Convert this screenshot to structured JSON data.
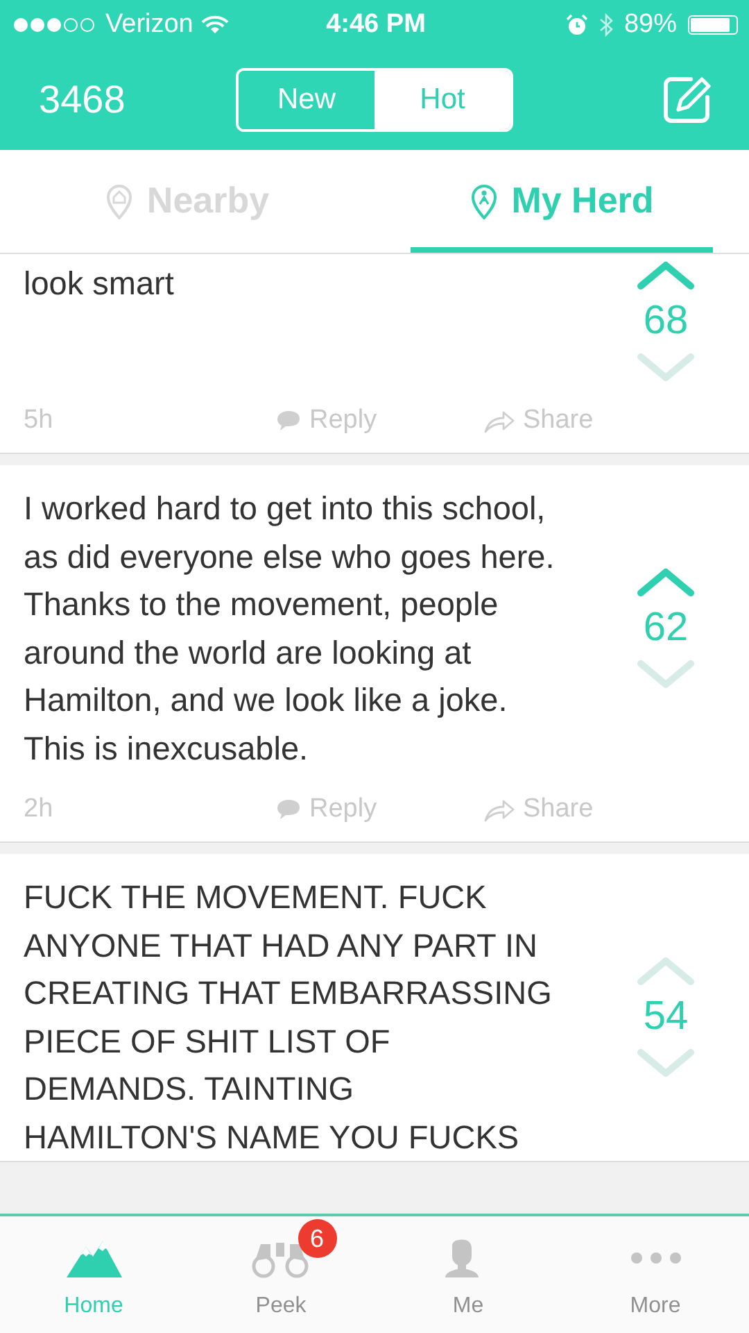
{
  "status_bar": {
    "carrier": "Verizon",
    "time": "4:46 PM",
    "battery_text": "89%",
    "battery": {
      "level": 0.89
    }
  },
  "header": {
    "karma": "3468",
    "sort_tabs": [
      {
        "label": "New",
        "selected": true
      },
      {
        "label": "Hot",
        "selected": false
      }
    ]
  },
  "feed_tabs": [
    {
      "label": "Nearby",
      "selected": false
    },
    {
      "label": "My Herd",
      "selected": true
    }
  ],
  "posts": [
    {
      "text": "look smart",
      "score": "68",
      "upvoted": true,
      "downvoted": false,
      "time": "5h",
      "reply": "Reply",
      "share": "Share"
    },
    {
      "text": "I worked hard to get into this school, as did everyone else who goes here. Thanks to the movement, people around the world are looking at Hamilton, and we look like a joke. This is inexcusable.",
      "score": "62",
      "upvoted": true,
      "downvoted": false,
      "time": "2h",
      "reply": "Reply",
      "share": "Share"
    },
    {
      "text": "FUCK THE MOVEMENT. FUCK ANYONE THAT HAD ANY PART IN CREATING THAT EMBARRASSING PIECE OF SHIT LIST OF DEMANDS. TAINTING HAMILTON'S NAME YOU FUCKS",
      "score": "54",
      "upvoted": false,
      "downvoted": false
    }
  ],
  "tab_bar": [
    {
      "kind": "home",
      "label": "Home",
      "selected": true
    },
    {
      "kind": "peek",
      "label": "Peek",
      "selected": false,
      "badge": "6"
    },
    {
      "kind": "me",
      "label": "Me",
      "selected": false
    },
    {
      "kind": "more",
      "label": "More",
      "selected": false
    }
  ]
}
